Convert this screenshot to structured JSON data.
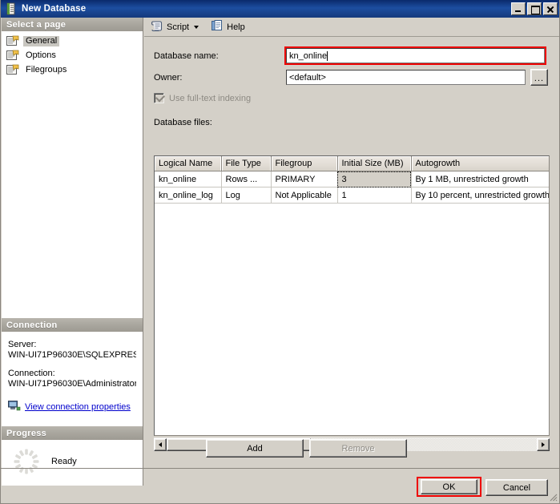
{
  "window": {
    "title": "New Database",
    "icon": "database-window-icon",
    "minimize_label": "Minimize",
    "maximize_label": "Maximize",
    "close_label": "Close"
  },
  "sidebar": {
    "select_page_header": "Select a page",
    "pages": [
      {
        "label": "General",
        "selected": true,
        "icon": "page-icon"
      },
      {
        "label": "Options",
        "selected": false,
        "icon": "page-icon"
      },
      {
        "label": "Filegroups",
        "selected": false,
        "icon": "page-icon"
      }
    ],
    "connection": {
      "header": "Connection",
      "server_label": "Server:",
      "server_value": "WIN-UI71P96030E\\SQLEXPRES",
      "connection_label": "Connection:",
      "connection_value": "WIN-UI71P96030E\\Administrator",
      "view_properties_link": "View connection properties",
      "link_icon": "connection-properties-icon"
    },
    "progress": {
      "header": "Progress",
      "status": "Ready",
      "icon": "progress-spinner-icon"
    }
  },
  "toolbar": {
    "script_label": "Script",
    "script_icon": "script-icon",
    "script_dropdown_icon": "chevron-down-icon",
    "help_label": "Help",
    "help_icon": "help-icon"
  },
  "form": {
    "database_name_label": "Database name:",
    "database_name_value": "kn_online",
    "database_name_highlight_color": "#ee0000",
    "owner_label": "Owner:",
    "owner_value": "<default>",
    "owner_browse_label": "...",
    "fulltext_label": "Use full-text indexing",
    "fulltext_checked": true,
    "fulltext_disabled": true,
    "database_files_label": "Database files:"
  },
  "grid": {
    "columns": [
      "Logical Name",
      "File Type",
      "Filegroup",
      "Initial Size (MB)",
      "Autogrowth"
    ],
    "rows": [
      {
        "logical_name": "kn_online",
        "file_type": "Rows ...",
        "filegroup": "PRIMARY",
        "initial_size": "3",
        "autogrowth": "By 1 MB, unrestricted growth",
        "selected_cell": "initial_size"
      },
      {
        "logical_name": "kn_online_log",
        "file_type": "Log",
        "filegroup": "Not Applicable",
        "initial_size": "1",
        "autogrowth": "By 10 percent, unrestricted growth",
        "selected_cell": null
      }
    ],
    "scroll_left_icon": "scroll-left-arrow-icon",
    "scroll_right_icon": "scroll-right-arrow-icon"
  },
  "buttons": {
    "add": "Add",
    "remove": "Remove",
    "remove_disabled": true,
    "ok": "OK",
    "ok_highlight_color": "#ee0000",
    "cancel": "Cancel"
  }
}
